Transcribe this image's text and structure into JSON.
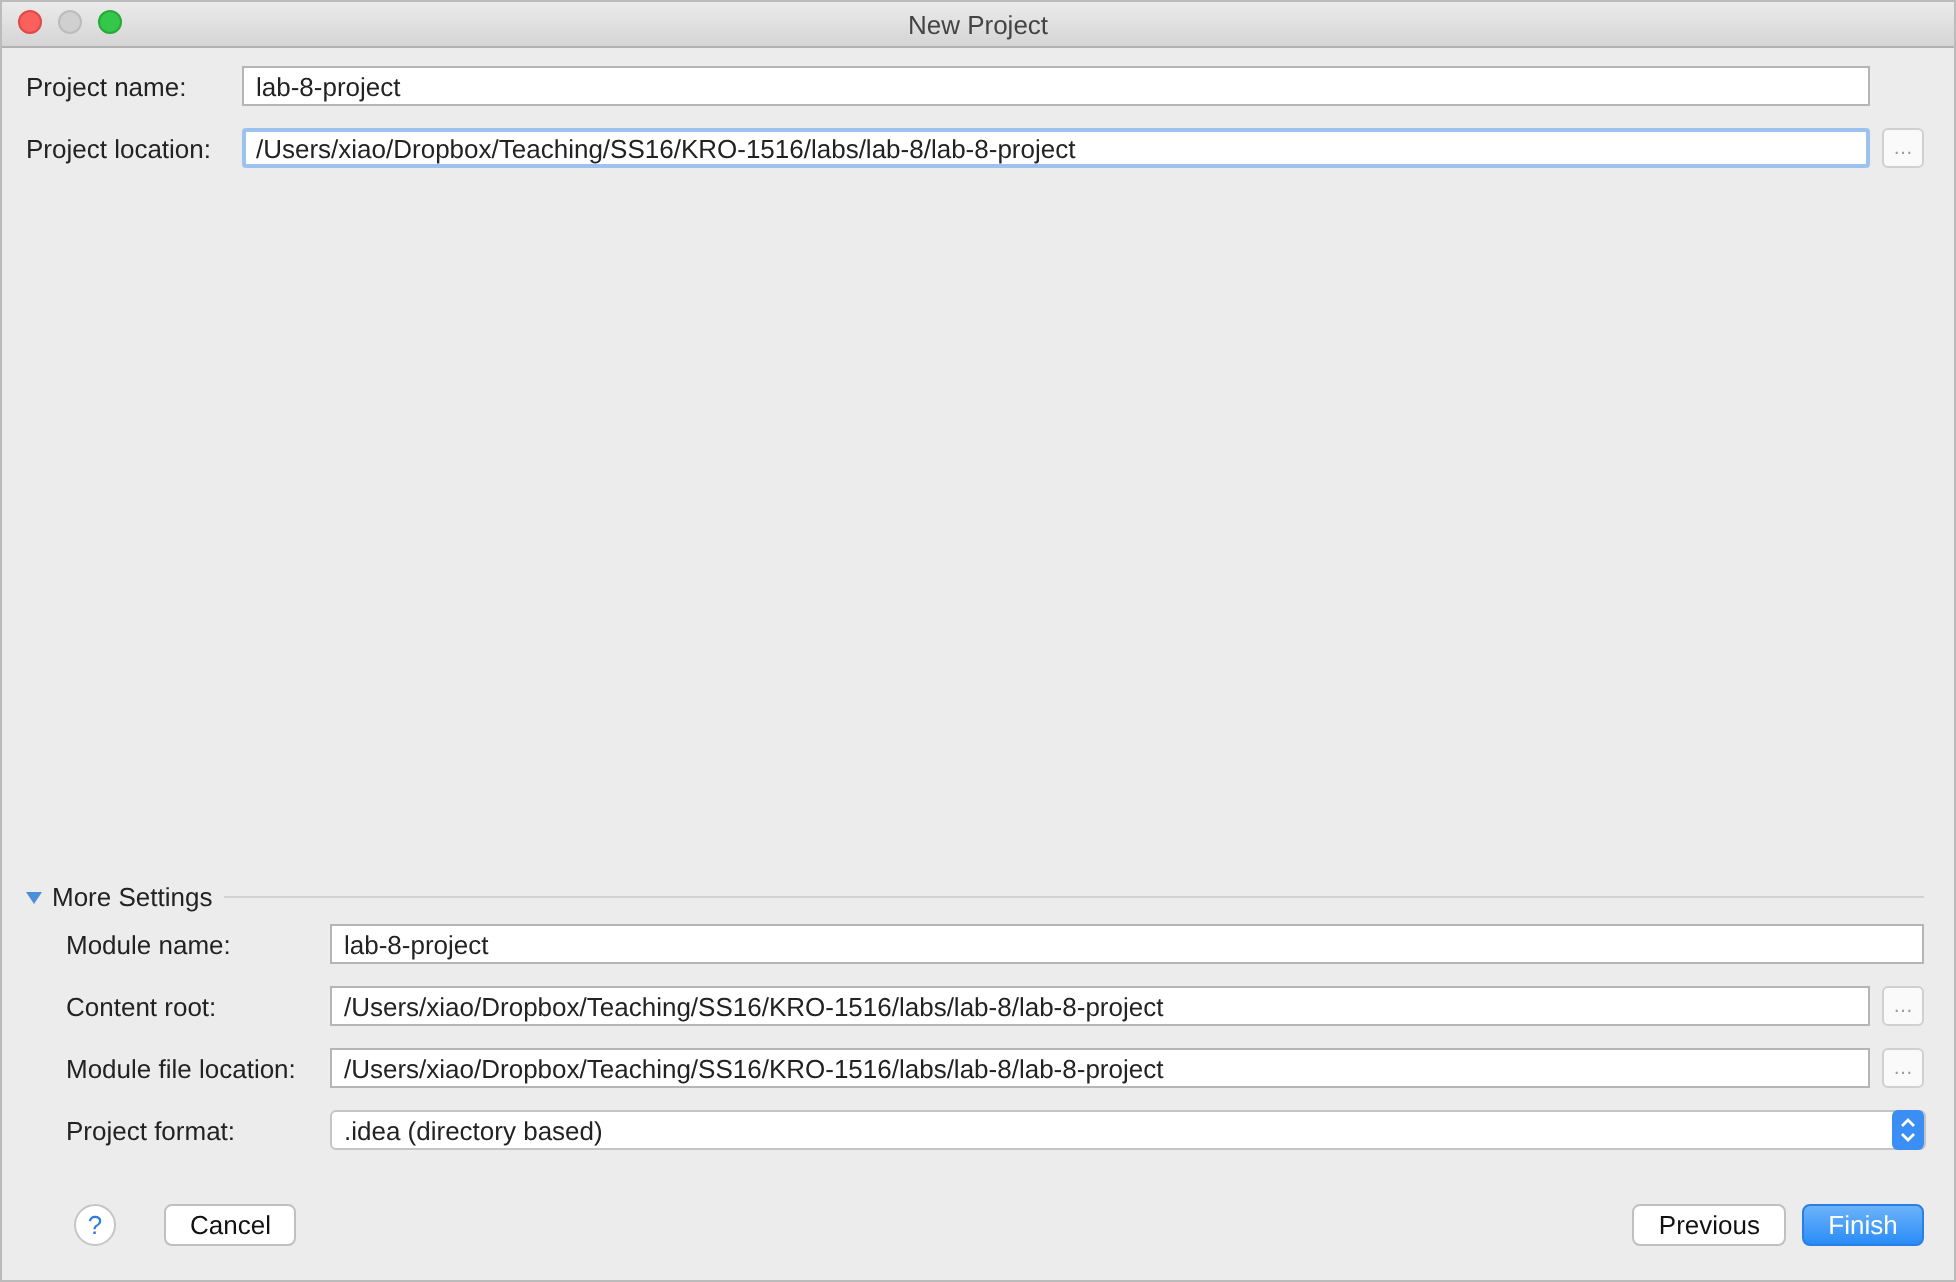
{
  "window": {
    "title": "New Project"
  },
  "project_fields": [
    {
      "label": "Project name:",
      "value": "lab-8-project",
      "focused": false
    },
    {
      "label": "Project location:",
      "value": "/Users/xiao/Dropbox/Teaching/SS16/KRO-1516/labs/lab-8/lab-8-project",
      "focused": true,
      "browse_button": "…"
    }
  ],
  "more_settings": {
    "title": "More Settings",
    "expanded": true,
    "fields": [
      {
        "kind": "text",
        "label": "Module name:",
        "value": "lab-8-project"
      },
      {
        "kind": "text",
        "label": "Content root:",
        "value": "/Users/xiao/Dropbox/Teaching/SS16/KRO-1516/labs/lab-8/lab-8-project",
        "browse_button": "…"
      },
      {
        "kind": "text",
        "label": "Module file location:",
        "value": "/Users/xiao/Dropbox/Teaching/SS16/KRO-1516/labs/lab-8/lab-8-project",
        "browse_button": "…"
      },
      {
        "kind": "select",
        "label": "Project format:",
        "value": ".idea (directory based)"
      }
    ]
  },
  "footer": {
    "help_button": "?",
    "buttons": [
      {
        "label": "Cancel",
        "primary": false
      },
      {
        "label": "Previous",
        "primary": false
      },
      {
        "label": "Finish",
        "primary": true
      }
    ]
  }
}
